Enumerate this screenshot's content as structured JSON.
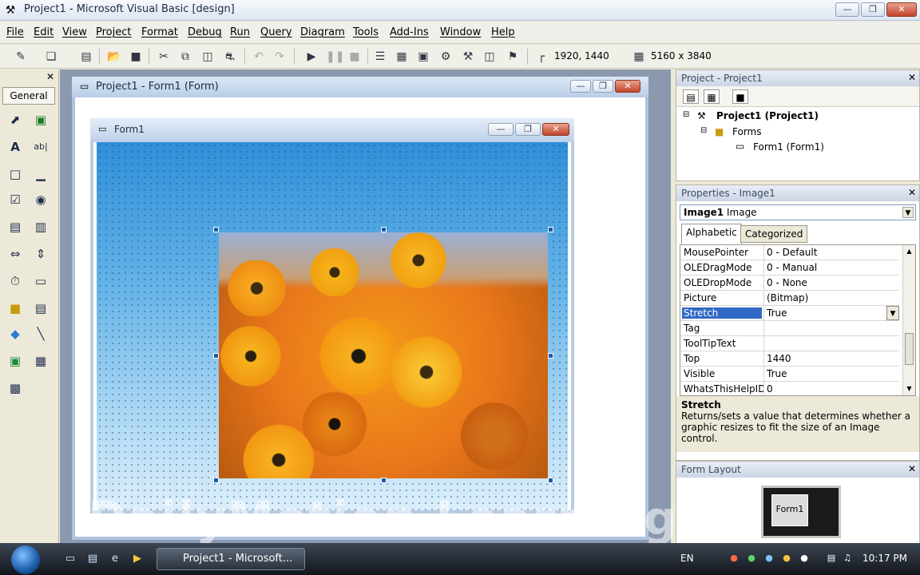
{
  "app": {
    "title": "Project1 - Microsoft Visual Basic [design]"
  },
  "menu": [
    "File",
    "Edit",
    "View",
    "Project",
    "Format",
    "Debug",
    "Run",
    "Query",
    "Diagram",
    "Tools",
    "Add-Ins",
    "Window",
    "Help"
  ],
  "toolbar": {
    "position": "1920, 1440",
    "size": "5160 x 3840"
  },
  "toolbox": {
    "tab": "General"
  },
  "designer": {
    "title": "Project1 - Form1 (Form)",
    "form_title": "Form1"
  },
  "project_explorer": {
    "title": "Project - Project1",
    "root": "Project1 (Project1)",
    "folder": "Forms",
    "item": "Form1 (Form1)"
  },
  "properties": {
    "title": "Properties - Image1",
    "object_name": "Image1",
    "object_type": "Image",
    "tabs": [
      "Alphabetic",
      "Categorized"
    ],
    "rows": [
      {
        "name": "MousePointer",
        "value": "0 - Default"
      },
      {
        "name": "OLEDragMode",
        "value": "0 - Manual"
      },
      {
        "name": "OLEDropMode",
        "value": "0 - None"
      },
      {
        "name": "Picture",
        "value": "(Bitmap)"
      },
      {
        "name": "Stretch",
        "value": "True"
      },
      {
        "name": "Tag",
        "value": ""
      },
      {
        "name": "ToolTipText",
        "value": ""
      },
      {
        "name": "Top",
        "value": "1440"
      },
      {
        "name": "Visible",
        "value": "True"
      },
      {
        "name": "WhatsThisHelpID",
        "value": "0"
      }
    ],
    "selected": "Stretch",
    "description_title": "Stretch",
    "description": "Returns/sets a value that determines whether a graphic resizes to fit the size of an Image control."
  },
  "form_layout": {
    "title": "Form Layout",
    "mini_label": "Form1"
  },
  "watermark": "DailyMotion Learning",
  "taskbar": {
    "task": "Project1 - Microsoft...",
    "lang": "EN",
    "time": "10:17 PM"
  }
}
